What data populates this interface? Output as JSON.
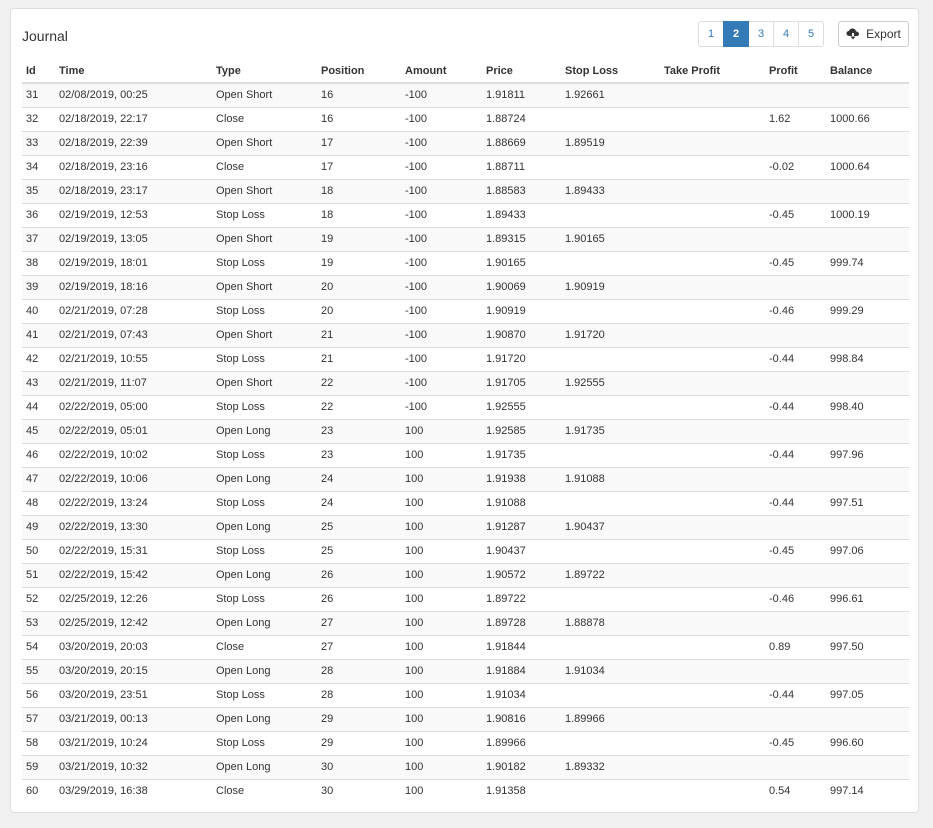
{
  "title": "Journal",
  "pagination": {
    "pages": [
      "1",
      "2",
      "3",
      "4",
      "5"
    ],
    "active_index": 1
  },
  "export_label": "Export",
  "columns": [
    "Id",
    "Time",
    "Type",
    "Position",
    "Amount",
    "Price",
    "Stop Loss",
    "Take Profit",
    "Profit",
    "Balance"
  ],
  "rows": [
    [
      "31",
      "02/08/2019, 00:25",
      "Open Short",
      "16",
      "-100",
      "1.91811",
      "1.92661",
      "",
      "",
      ""
    ],
    [
      "32",
      "02/18/2019, 22:17",
      "Close",
      "16",
      "-100",
      "1.88724",
      "",
      "",
      "1.62",
      "1000.66"
    ],
    [
      "33",
      "02/18/2019, 22:39",
      "Open Short",
      "17",
      "-100",
      "1.88669",
      "1.89519",
      "",
      "",
      ""
    ],
    [
      "34",
      "02/18/2019, 23:16",
      "Close",
      "17",
      "-100",
      "1.88711",
      "",
      "",
      "-0.02",
      "1000.64"
    ],
    [
      "35",
      "02/18/2019, 23:17",
      "Open Short",
      "18",
      "-100",
      "1.88583",
      "1.89433",
      "",
      "",
      ""
    ],
    [
      "36",
      "02/19/2019, 12:53",
      "Stop Loss",
      "18",
      "-100",
      "1.89433",
      "",
      "",
      "-0.45",
      "1000.19"
    ],
    [
      "37",
      "02/19/2019, 13:05",
      "Open Short",
      "19",
      "-100",
      "1.89315",
      "1.90165",
      "",
      "",
      ""
    ],
    [
      "38",
      "02/19/2019, 18:01",
      "Stop Loss",
      "19",
      "-100",
      "1.90165",
      "",
      "",
      "-0.45",
      "999.74"
    ],
    [
      "39",
      "02/19/2019, 18:16",
      "Open Short",
      "20",
      "-100",
      "1.90069",
      "1.90919",
      "",
      "",
      ""
    ],
    [
      "40",
      "02/21/2019, 07:28",
      "Stop Loss",
      "20",
      "-100",
      "1.90919",
      "",
      "",
      "-0.46",
      "999.29"
    ],
    [
      "41",
      "02/21/2019, 07:43",
      "Open Short",
      "21",
      "-100",
      "1.90870",
      "1.91720",
      "",
      "",
      ""
    ],
    [
      "42",
      "02/21/2019, 10:55",
      "Stop Loss",
      "21",
      "-100",
      "1.91720",
      "",
      "",
      "-0.44",
      "998.84"
    ],
    [
      "43",
      "02/21/2019, 11:07",
      "Open Short",
      "22",
      "-100",
      "1.91705",
      "1.92555",
      "",
      "",
      ""
    ],
    [
      "44",
      "02/22/2019, 05:00",
      "Stop Loss",
      "22",
      "-100",
      "1.92555",
      "",
      "",
      "-0.44",
      "998.40"
    ],
    [
      "45",
      "02/22/2019, 05:01",
      "Open Long",
      "23",
      "100",
      "1.92585",
      "1.91735",
      "",
      "",
      ""
    ],
    [
      "46",
      "02/22/2019, 10:02",
      "Stop Loss",
      "23",
      "100",
      "1.91735",
      "",
      "",
      "-0.44",
      "997.96"
    ],
    [
      "47",
      "02/22/2019, 10:06",
      "Open Long",
      "24",
      "100",
      "1.91938",
      "1.91088",
      "",
      "",
      ""
    ],
    [
      "48",
      "02/22/2019, 13:24",
      "Stop Loss",
      "24",
      "100",
      "1.91088",
      "",
      "",
      "-0.44",
      "997.51"
    ],
    [
      "49",
      "02/22/2019, 13:30",
      "Open Long",
      "25",
      "100",
      "1.91287",
      "1.90437",
      "",
      "",
      ""
    ],
    [
      "50",
      "02/22/2019, 15:31",
      "Stop Loss",
      "25",
      "100",
      "1.90437",
      "",
      "",
      "-0.45",
      "997.06"
    ],
    [
      "51",
      "02/22/2019, 15:42",
      "Open Long",
      "26",
      "100",
      "1.90572",
      "1.89722",
      "",
      "",
      ""
    ],
    [
      "52",
      "02/25/2019, 12:26",
      "Stop Loss",
      "26",
      "100",
      "1.89722",
      "",
      "",
      "-0.46",
      "996.61"
    ],
    [
      "53",
      "02/25/2019, 12:42",
      "Open Long",
      "27",
      "100",
      "1.89728",
      "1.88878",
      "",
      "",
      ""
    ],
    [
      "54",
      "03/20/2019, 20:03",
      "Close",
      "27",
      "100",
      "1.91844",
      "",
      "",
      "0.89",
      "997.50"
    ],
    [
      "55",
      "03/20/2019, 20:15",
      "Open Long",
      "28",
      "100",
      "1.91884",
      "1.91034",
      "",
      "",
      ""
    ],
    [
      "56",
      "03/20/2019, 23:51",
      "Stop Loss",
      "28",
      "100",
      "1.91034",
      "",
      "",
      "-0.44",
      "997.05"
    ],
    [
      "57",
      "03/21/2019, 00:13",
      "Open Long",
      "29",
      "100",
      "1.90816",
      "1.89966",
      "",
      "",
      ""
    ],
    [
      "58",
      "03/21/2019, 10:24",
      "Stop Loss",
      "29",
      "100",
      "1.89966",
      "",
      "",
      "-0.45",
      "996.60"
    ],
    [
      "59",
      "03/21/2019, 10:32",
      "Open Long",
      "30",
      "100",
      "1.90182",
      "1.89332",
      "",
      "",
      ""
    ],
    [
      "60",
      "03/29/2019, 16:38",
      "Close",
      "30",
      "100",
      "1.91358",
      "",
      "",
      "0.54",
      "997.14"
    ]
  ],
  "colors": {
    "accent": "#337ab7",
    "border": "#dddddd",
    "stripe": "#f9f9f9"
  },
  "icons": {
    "export": "cloud-download-icon"
  }
}
